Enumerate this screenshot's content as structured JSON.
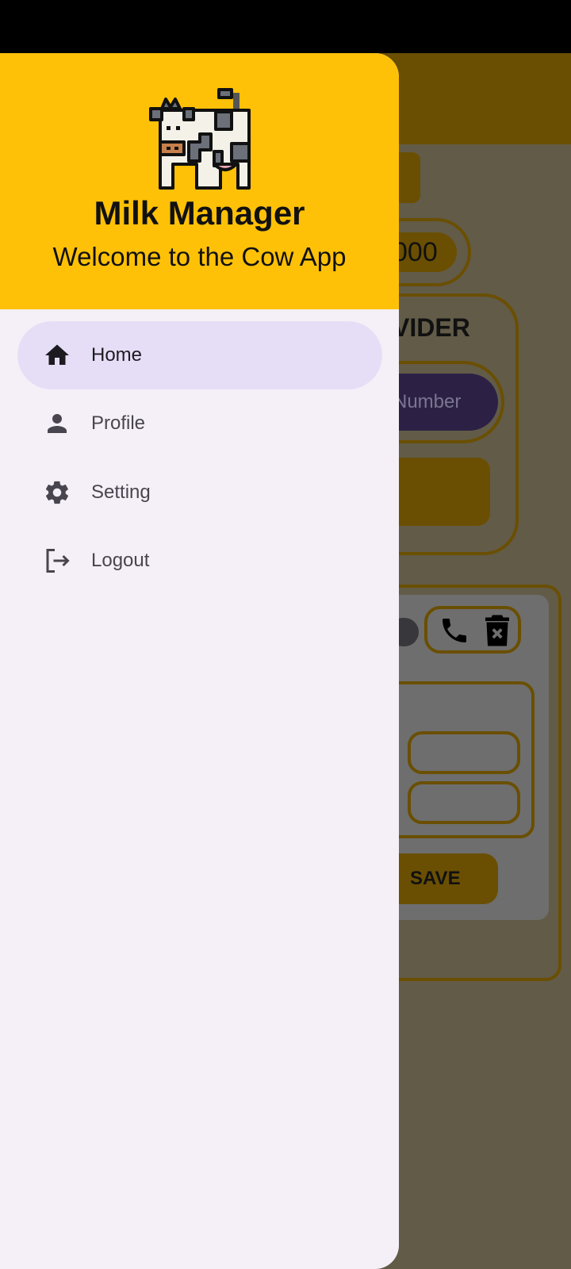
{
  "drawer": {
    "title": "Milk Manager",
    "subtitle": "Welcome to the Cow App",
    "items": [
      {
        "label": "Home",
        "icon": "home-icon",
        "active": true
      },
      {
        "label": "Profile",
        "icon": "person-icon"
      },
      {
        "label": "Setting",
        "icon": "gear-icon"
      },
      {
        "label": "Logout",
        "icon": "logout-icon"
      }
    ]
  },
  "background": {
    "amount_fragment": "000",
    "section_fragment": "VIDER",
    "number_placeholder_fragment": "Number",
    "save_label": "SAVE"
  },
  "colors": {
    "accent": "#FFC107",
    "drawer_bg": "#F5F0F7",
    "active_item": "#E6DEF6"
  }
}
